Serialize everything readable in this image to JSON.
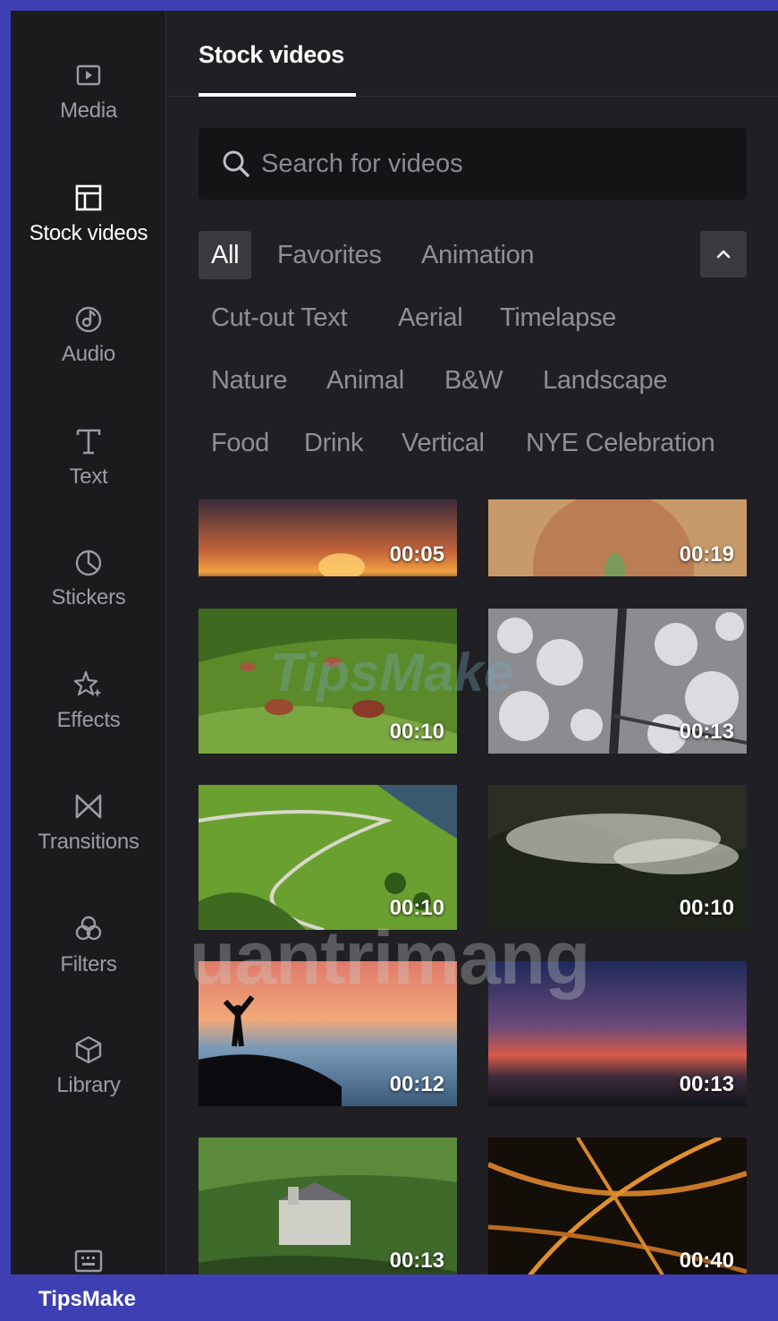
{
  "sidebar": {
    "items": [
      {
        "label": "Media",
        "icon": "media-play-icon"
      },
      {
        "label": "Stock videos",
        "icon": "layout-icon",
        "active": true
      },
      {
        "label": "Audio",
        "icon": "music-note-icon"
      },
      {
        "label": "Text",
        "icon": "text-T-icon"
      },
      {
        "label": "Stickers",
        "icon": "sticker-icon"
      },
      {
        "label": "Effects",
        "icon": "sparkle-icon"
      },
      {
        "label": "Transitions",
        "icon": "bowtie-icon"
      },
      {
        "label": "Filters",
        "icon": "filter-circles-icon"
      },
      {
        "label": "Library",
        "icon": "cube-icon"
      }
    ]
  },
  "panel": {
    "tab": "Stock videos",
    "search": {
      "placeholder": "Search for videos",
      "value": ""
    }
  },
  "categories": [
    "All",
    "Favorites",
    "Animation",
    "Cut-out Text",
    "Aerial",
    "Timelapse",
    "Nature",
    "Animal",
    "B&W",
    "Landscape",
    "Food",
    "Drink",
    "Vertical",
    "NYE Celebration"
  ],
  "active_category": "All",
  "videos": [
    {
      "duration": "00:05",
      "scene": "sunset-horizon"
    },
    {
      "duration": "00:19",
      "scene": "desert-aerial"
    },
    {
      "duration": "00:10",
      "scene": "cows-field"
    },
    {
      "duration": "00:13",
      "scene": "snowy-forest-road"
    },
    {
      "duration": "00:10",
      "scene": "winding-road-hills"
    },
    {
      "duration": "00:10",
      "scene": "misty-mountains"
    },
    {
      "duration": "00:12",
      "scene": "hiker-sunrise"
    },
    {
      "duration": "00:13",
      "scene": "dusk-sky"
    },
    {
      "duration": "00:13",
      "scene": "castle-aerial"
    },
    {
      "duration": "00:40",
      "scene": "highway-night"
    }
  ],
  "watermarks": [
    "TipsMake",
    "uantrimang"
  ],
  "footer": {
    "brand": "TipsMake"
  },
  "colors": {
    "frame": "#3e3fb3",
    "sidebar_bg": "#1b1b1e",
    "panel_bg": "#202024",
    "chip_active": "#3a3a40"
  }
}
